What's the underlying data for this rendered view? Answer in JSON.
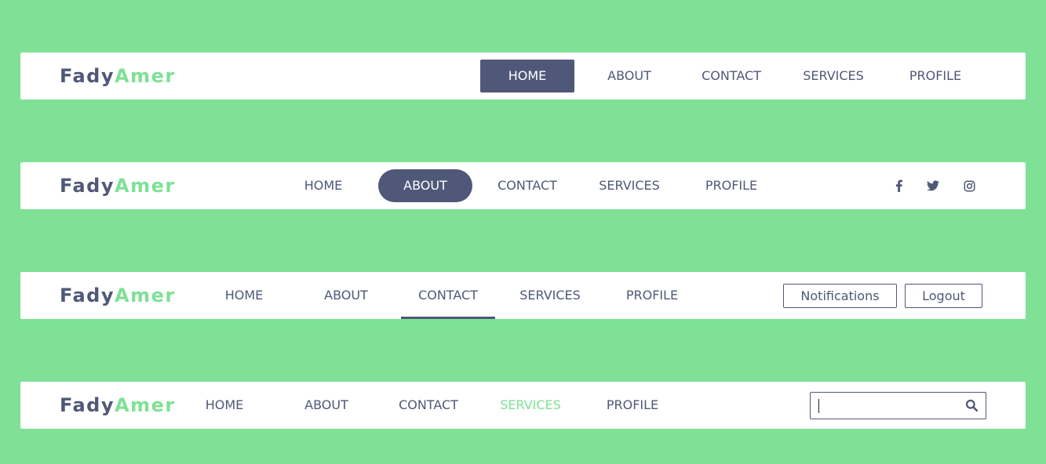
{
  "brand": {
    "first": "Fady",
    "last": "Amer"
  },
  "nav_items": [
    "HOME",
    "ABOUT",
    "CONTACT",
    "SERVICES",
    "PROFILE"
  ],
  "navbar1": {
    "active": "HOME"
  },
  "navbar2": {
    "active": "ABOUT",
    "social_icons": [
      "facebook-icon",
      "twitter-icon",
      "instagram-icon"
    ]
  },
  "navbar3": {
    "active": "CONTACT",
    "notifications_label": "Notifications",
    "logout_label": "Logout"
  },
  "navbar4": {
    "active": "SERVICES",
    "search_value": "",
    "search_icon": "search-icon"
  },
  "colors": {
    "background": "#7ee195",
    "brand_dark": "#4f5878",
    "brand_accent": "#7ee195",
    "navbar_bg": "#ffffff"
  }
}
